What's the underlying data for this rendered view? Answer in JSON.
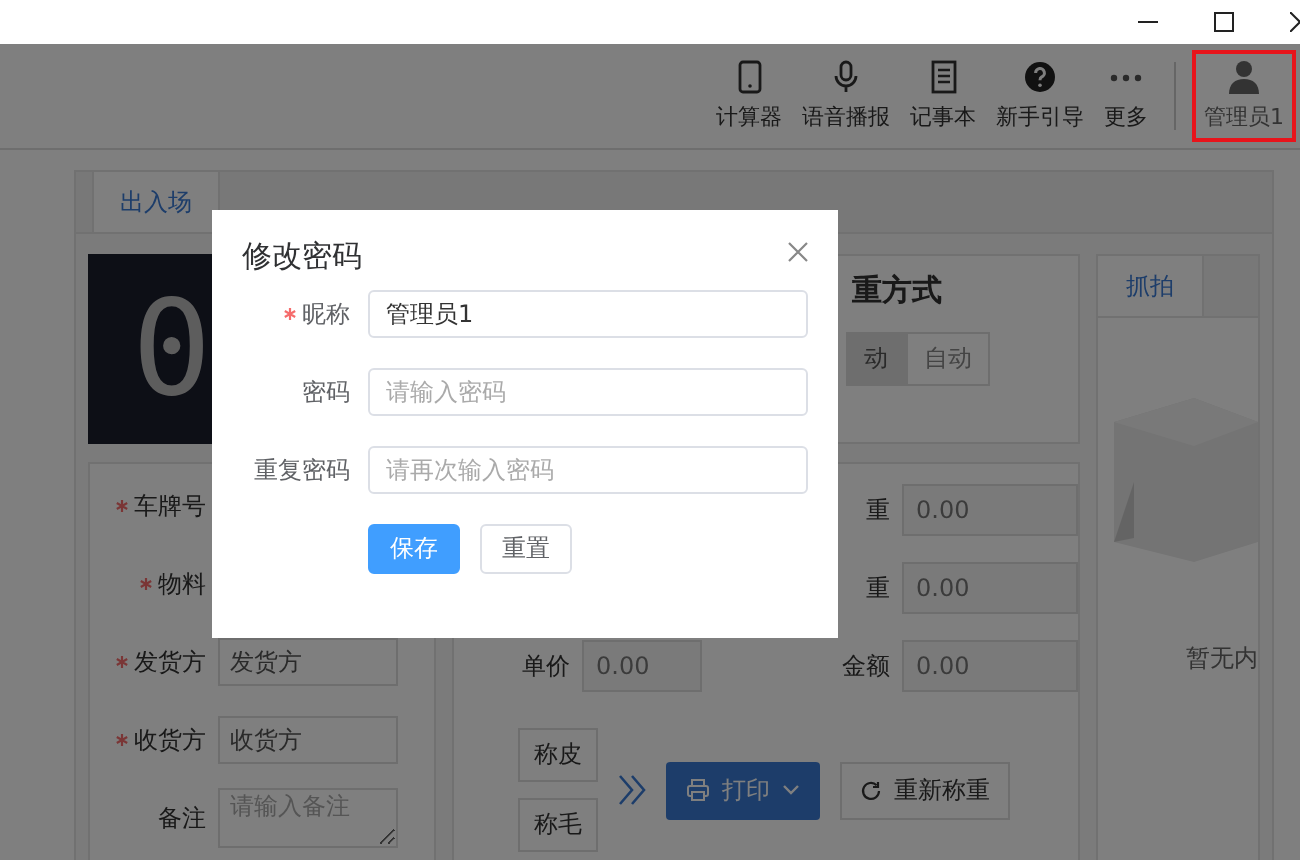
{
  "toolbar": {
    "items": [
      {
        "label": "计算器"
      },
      {
        "label": "语音播报"
      },
      {
        "label": "记事本"
      },
      {
        "label": "新手引导"
      },
      {
        "label": "更多"
      }
    ],
    "user": {
      "label": "管理员1",
      "highlighted": true
    }
  },
  "tabs": [
    {
      "label": "出入场",
      "selected": true
    }
  ],
  "display": {
    "digit": "0"
  },
  "weigh_mode": {
    "title": "重方式",
    "options": [
      {
        "label": "动",
        "selected": true
      },
      {
        "label": "自动",
        "selected": false
      }
    ]
  },
  "entry_form": [
    {
      "label": "车牌号",
      "required": true,
      "kind": "hidden"
    },
    {
      "label": "物料",
      "required": true,
      "kind": "hidden"
    },
    {
      "label": "发货方",
      "required": true,
      "kind": "input",
      "value": "发货方"
    },
    {
      "label": "收货方",
      "required": true,
      "kind": "input",
      "value": "收货方"
    },
    {
      "label": "备注",
      "required": false,
      "kind": "textarea",
      "placeholder": "请输入备注"
    }
  ],
  "weights": {
    "left": [
      {
        "label": "单价",
        "value": "0.00"
      }
    ],
    "right": [
      {
        "label": "重",
        "value": "0.00"
      },
      {
        "label": "重",
        "value": "0.00"
      },
      {
        "label": "金额",
        "value": "0.00"
      }
    ]
  },
  "weigh_buttons": [
    {
      "label": "称皮"
    },
    {
      "label": "称毛"
    }
  ],
  "print_button": {
    "label": "打印"
  },
  "reweigh_button": {
    "label": "重新称重"
  },
  "snapshot": {
    "tabs": [
      {
        "label": "抓拍",
        "selected": true
      }
    ],
    "empty_text": "暂无内"
  },
  "dialog": {
    "title": "修改密码",
    "fields": [
      {
        "label": "昵称",
        "required": true,
        "value": "管理员1"
      },
      {
        "label": "密码",
        "required": false,
        "placeholder": "请输入密码"
      },
      {
        "label": "重复密码",
        "required": false,
        "placeholder": "请再次输入密码"
      }
    ],
    "buttons": [
      {
        "label": "保存",
        "primary": true
      },
      {
        "label": "重置",
        "primary": false
      }
    ]
  }
}
